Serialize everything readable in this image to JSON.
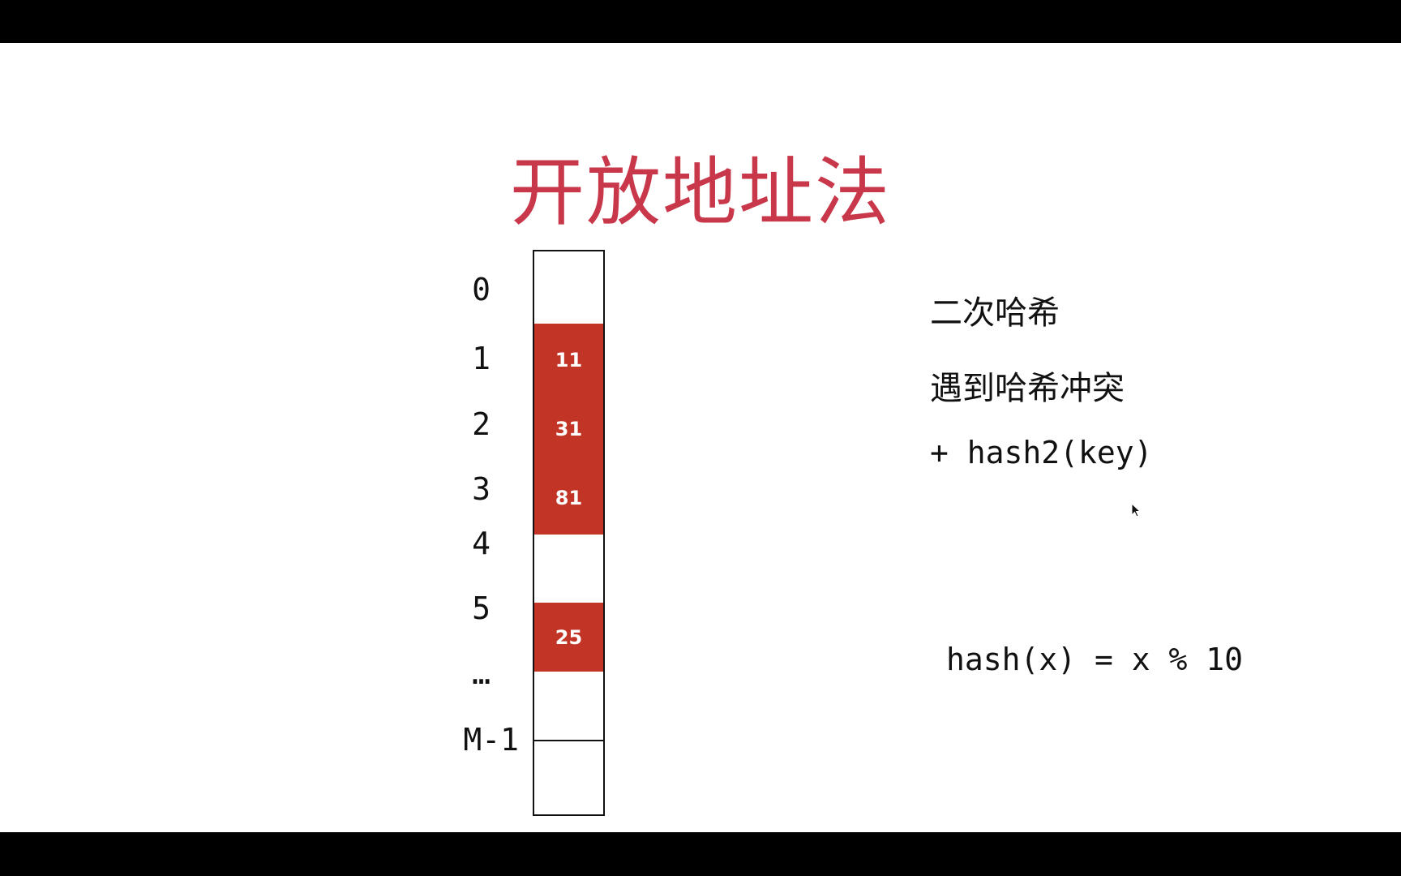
{
  "title": "开放地址法",
  "table": {
    "rows": [
      {
        "index": "0",
        "value": ""
      },
      {
        "index": "1",
        "value": "11"
      },
      {
        "index": "2",
        "value": "31"
      },
      {
        "index": "3",
        "value": "81"
      },
      {
        "index": "4",
        "value": ""
      },
      {
        "index": "5",
        "value": "25"
      },
      {
        "index": "…",
        "value": ""
      },
      {
        "index": "M-1",
        "value": ""
      }
    ]
  },
  "notes": {
    "line1": "二次哈希",
    "line2": "遇到哈希冲突",
    "line3": "+ hash2(key)"
  },
  "formula": "hash(x) = x % 10",
  "colors": {
    "title": "#c8384a",
    "filled_cell": "#c23526"
  }
}
